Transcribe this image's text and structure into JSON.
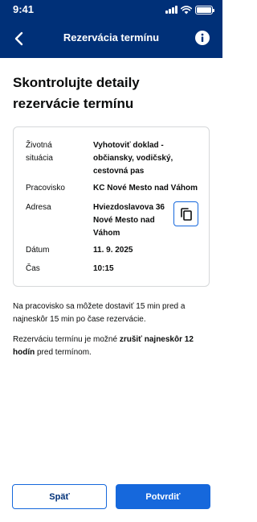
{
  "status_bar": {
    "time": "9:41"
  },
  "header": {
    "title": "Rezervácia termínu"
  },
  "icons": {
    "back": "chevron-left-icon",
    "info": "info-icon",
    "copy": "copy-icon",
    "signal": "signal-icon",
    "wifi": "wifi-icon",
    "battery": "battery-icon"
  },
  "page": {
    "heading": "Skontrolujte detaily rezervácie termínu"
  },
  "details": {
    "life_situation_label": "Životná situácia",
    "life_situation_value": "Vyhotoviť doklad - občiansky, vodičský, cestovná pas",
    "workplace_label": "Pracovisko",
    "workplace_value": "KC Nové Mesto nad Váhom",
    "address_label": "Adresa",
    "address_value": "Hviezdoslavova 36 Nové Mesto nad Váhom",
    "date_label": "Dátum",
    "date_value": "11. 9. 2025",
    "time_label": "Čas",
    "time_value": "10:15"
  },
  "notes": {
    "arrival": "Na pracovisko sa môžete dostaviť 15 min pred a najneskôr 15 min po čase rezervácie.",
    "cancel_prefix": "Rezerváciu termínu je možné ",
    "cancel_bold": "zrušiť najneskôr 12 hodín",
    "cancel_suffix": " pred termínom."
  },
  "actions": {
    "back_label": "Späť",
    "confirm_label": "Potvrdiť"
  },
  "colors": {
    "header_bg": "#003078",
    "primary": "#1668dc",
    "border": "#d6d8da"
  }
}
